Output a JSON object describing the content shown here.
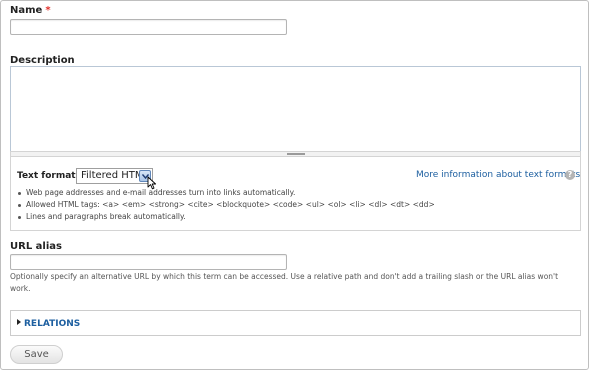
{
  "name_field": {
    "label": "Name",
    "required_mark": "*",
    "value": ""
  },
  "description_field": {
    "label": "Description",
    "value": ""
  },
  "text_format": {
    "label": "Text format",
    "selected": "Filtered HTML",
    "help_link": "More information about text formats",
    "help_icon": "?",
    "tips": [
      "Web page addresses and e-mail addresses turn into links automatically.",
      "Allowed HTML tags: <a> <em> <strong> <cite> <blockquote> <code> <ul> <ol> <li> <dl> <dt> <dd>",
      "Lines and paragraphs break automatically."
    ]
  },
  "url_alias": {
    "label": "URL alias",
    "value": "",
    "description": "Optionally specify an alternative URL by which this term can be accessed. Use a relative path and don't add a trailing slash or the URL alias won't work."
  },
  "relations": {
    "label": "RELATIONS"
  },
  "actions": {
    "save_label": "Save"
  },
  "colors": {
    "link": "#1d5fa0",
    "required": "#e2302a"
  },
  "icons": {
    "select_arrow": "chevron-down-icon",
    "cursor": "mouse-pointer-icon",
    "help": "help-icon",
    "collapse": "triangle-right-icon"
  }
}
